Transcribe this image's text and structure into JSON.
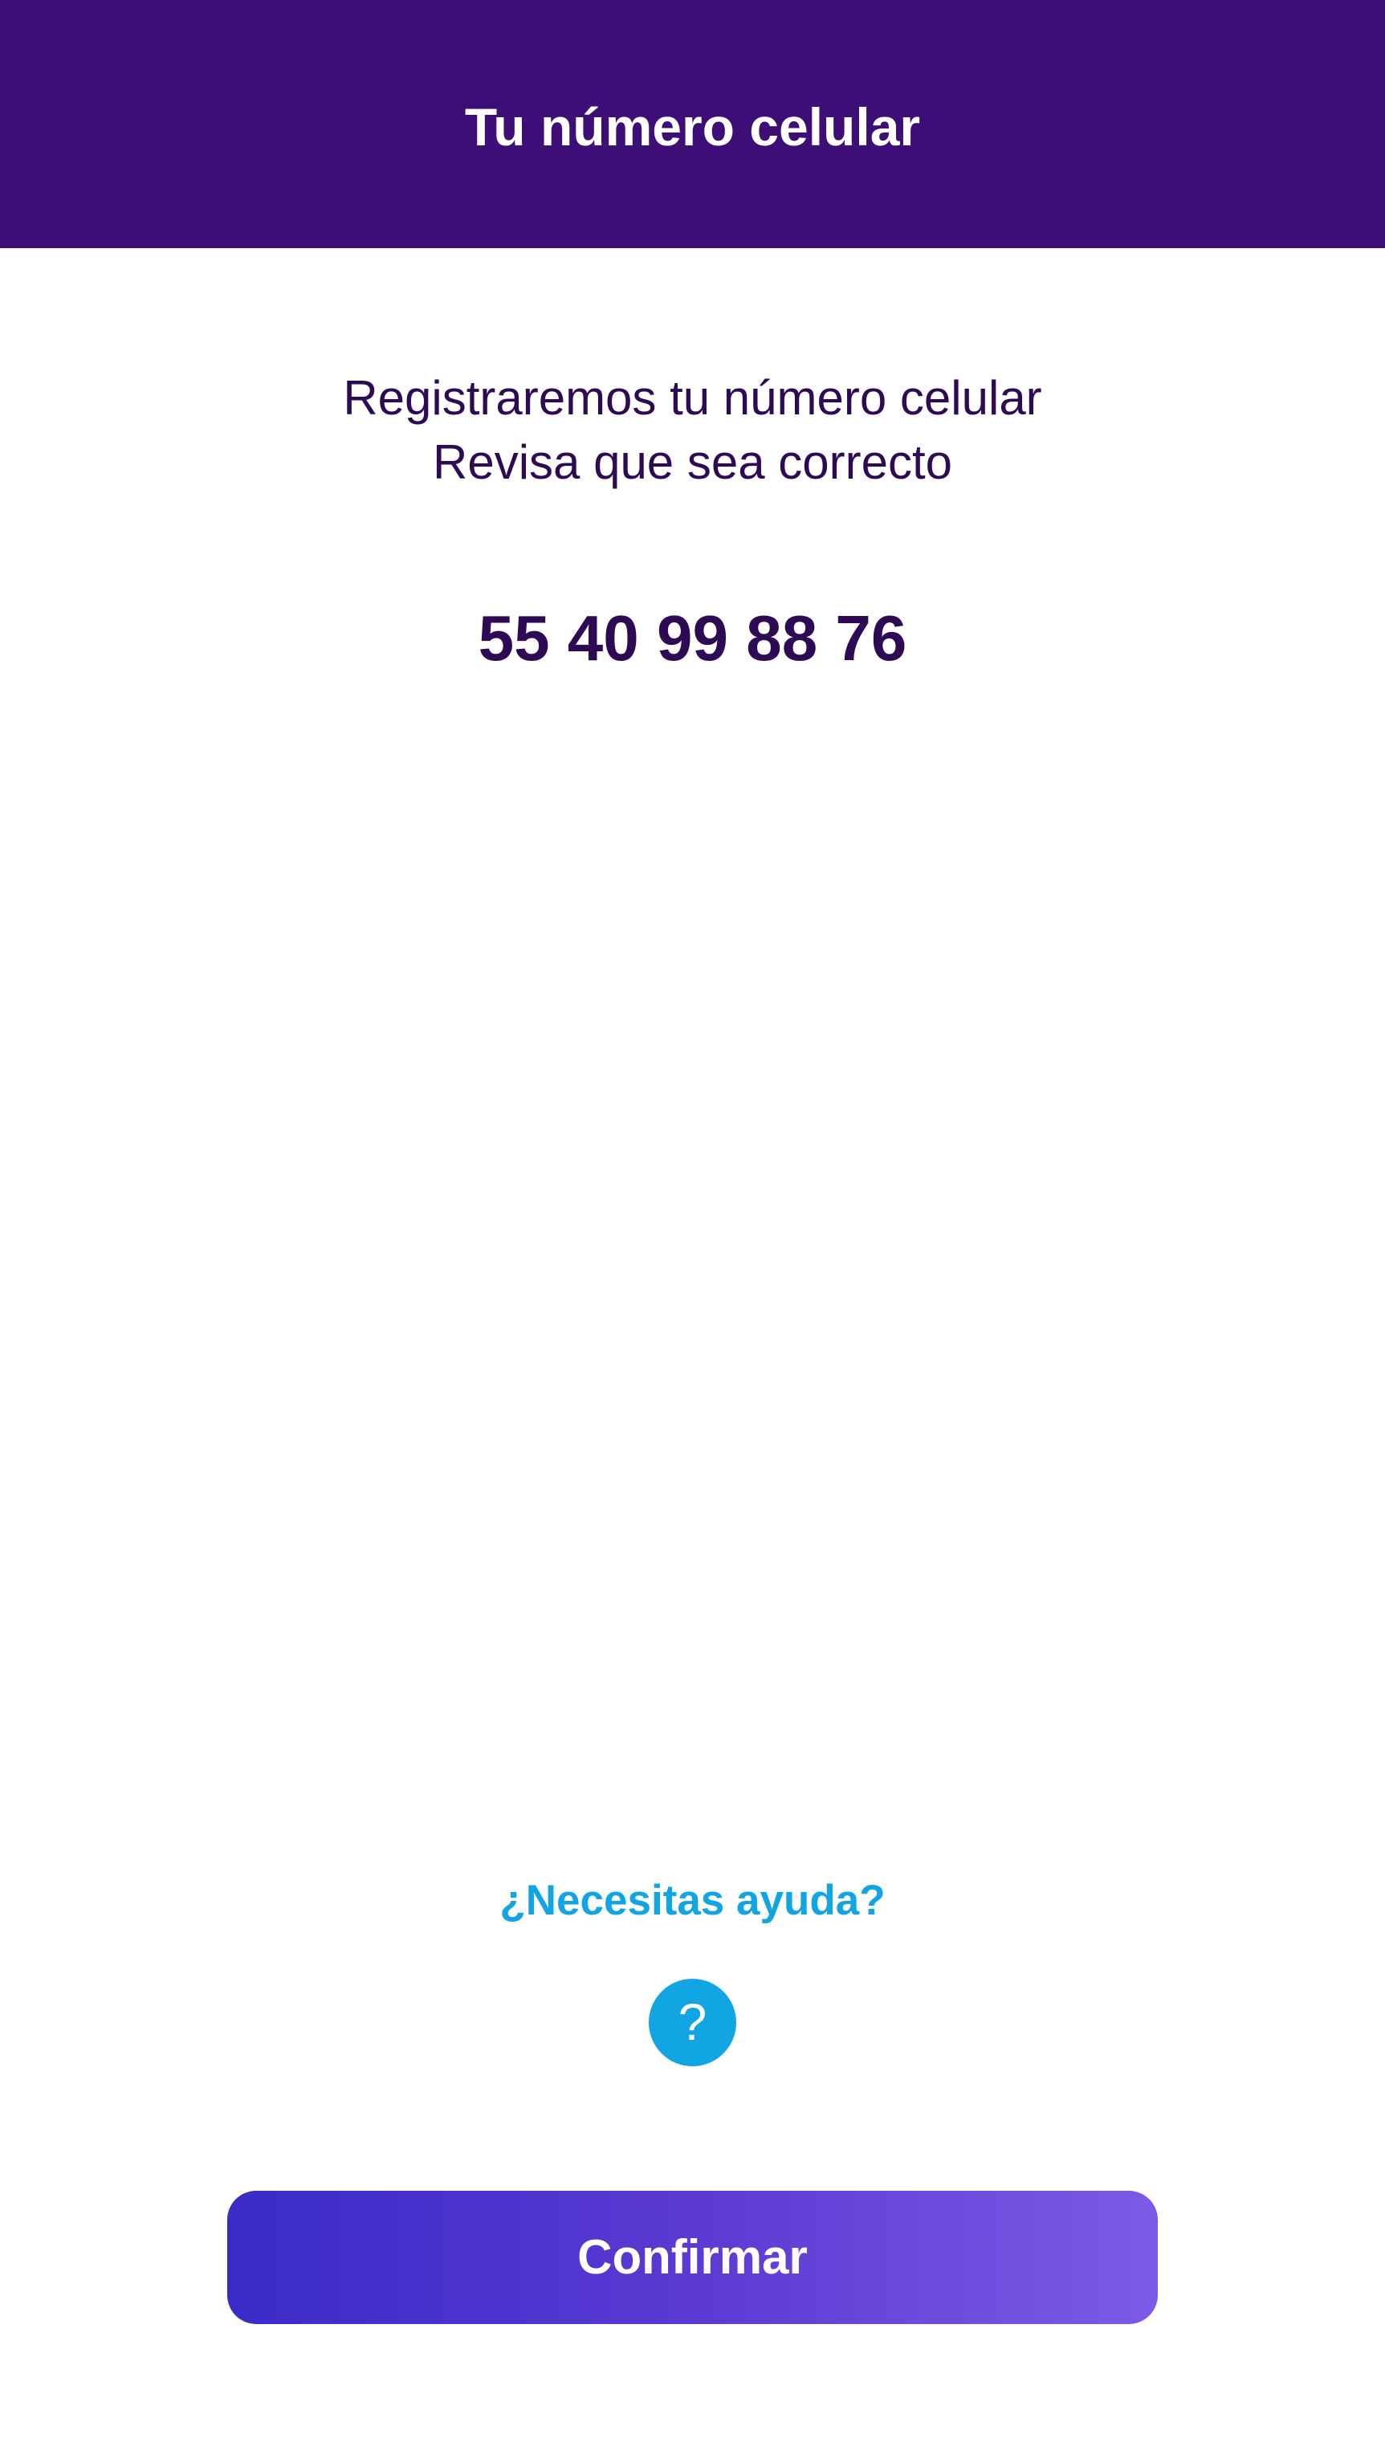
{
  "header": {
    "title": "Tu número celular"
  },
  "intro": {
    "line1": "Registraremos tu número celular",
    "line2": "Revisa que sea correcto"
  },
  "phone": {
    "number": "55 40 99 88 76"
  },
  "help": {
    "link_label": "¿Necesitas ayuda?",
    "icon_glyph": "?",
    "icon_name": "question-icon"
  },
  "actions": {
    "confirm_label": "Confirmar"
  },
  "colors": {
    "header_bg": "#3c0e76",
    "text_primary": "#2e0a54",
    "accent_blue": "#12a5e3",
    "button_gradient_start": "#3a2bc8",
    "button_gradient_end": "#7d5ae6"
  }
}
